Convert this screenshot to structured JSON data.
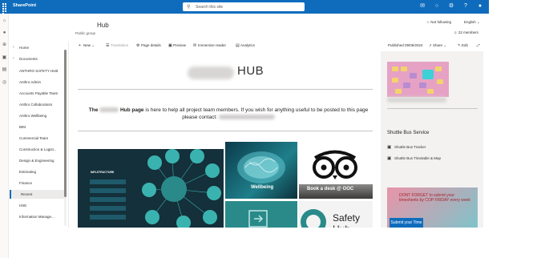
{
  "suitebar": {
    "app_name": "SharePoint",
    "search_placeholder": "Search this site"
  },
  "site": {
    "title": "Hub",
    "subtitle": "Public group",
    "not_following": "Not following",
    "language": "English",
    "members": "22 members"
  },
  "nav": {
    "items": [
      {
        "label": "Home",
        "chevron": true
      },
      {
        "label": "Documents",
        "chevron": true
      },
      {
        "label": "ANTHRO SAFETY HUB"
      },
      {
        "label": "Anthro Admin"
      },
      {
        "label": "Accounts Payable Team"
      },
      {
        "label": "Anthro Collaborators"
      },
      {
        "label": "Anthro Wellbeing"
      },
      {
        "label": "BIM"
      },
      {
        "label": "Commercial Team"
      },
      {
        "label": "Construction & Logist..."
      },
      {
        "label": "Design & Engineering"
      },
      {
        "label": "Estimating"
      },
      {
        "label": "Finance"
      },
      {
        "label": "Recent",
        "selected": true
      },
      {
        "label": "HSE"
      },
      {
        "label": "Information Manage..."
      }
    ]
  },
  "commandbar": {
    "new": "New",
    "translation": "Translation",
    "page_details": "Page details",
    "preview": "Preview",
    "immersive_reader": "Immersive reader",
    "analytics": "Analytics",
    "published": "Published 09/06/2024",
    "share": "Share",
    "edit": "Edit"
  },
  "main": {
    "hub_word": "HUB",
    "intro_public": "The",
    "intro_hub_page": "Hub page",
    "intro_rest": "is here to help all project team members. If you wish for anything useful to be posted to this page please contact:"
  },
  "tiles": {
    "structure_label": "INFLSTRUCTURE",
    "wellbeing": "Wellbeing",
    "book_desk": "Book a desk @ OOC",
    "safety": "Safety Hub"
  },
  "rightcol": {
    "heading": "Shuttle Bus Service",
    "links": [
      "Shuttle Bus Tracker",
      "Shuttle Bus Timetable & Map"
    ],
    "promo_text": "DONT FORGET to submit your timesheets by COP FRIDAY every week",
    "promo_button": "Submit your Time"
  },
  "colors": {
    "suitebar": "#0f6cbd",
    "accent": "#0f6cbd"
  }
}
